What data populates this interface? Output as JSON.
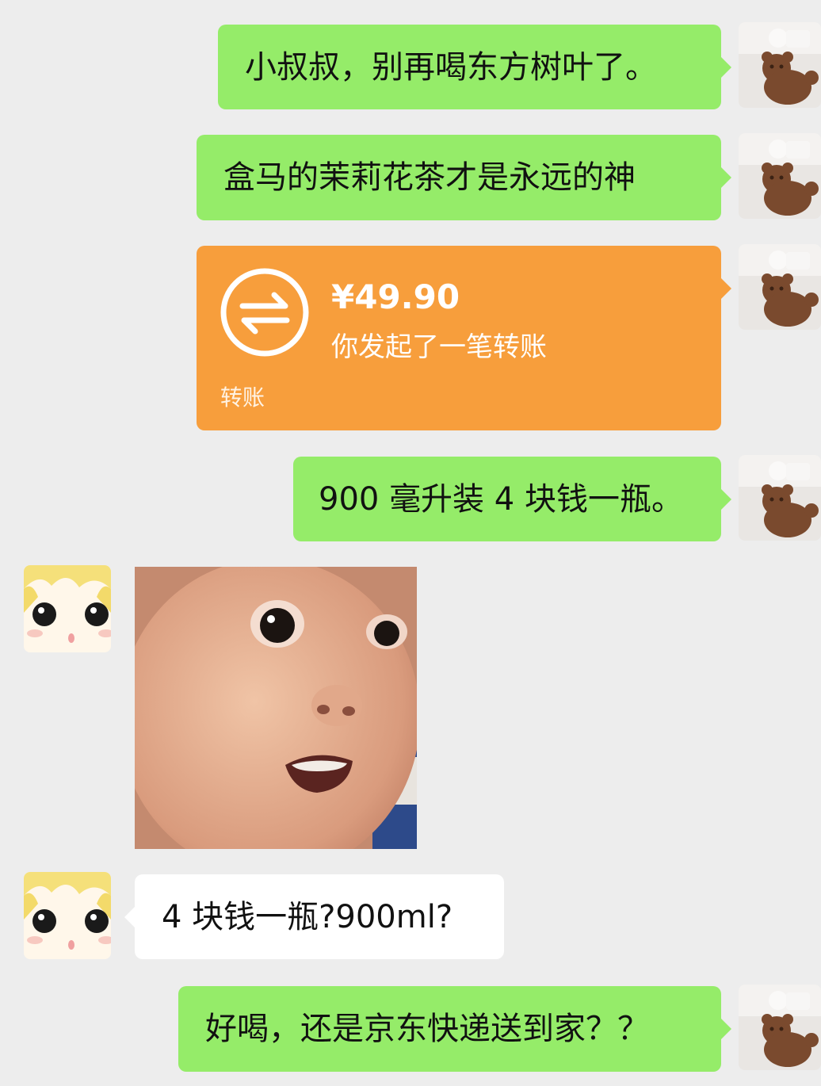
{
  "messages": {
    "m1": "小叔叔，别再喝东方树叶了。",
    "m2": "盒马的茉莉花茶才是永远的神",
    "m4": "900 毫升装 4 块钱一瓶。",
    "m6": "4 块钱一瓶?900ml?",
    "m7": "好喝，还是京东快递送到家？？"
  },
  "transfer": {
    "amount": "¥49.90",
    "description": "你发起了一笔转账",
    "label": "转账"
  },
  "colors": {
    "background": "#ededed",
    "my_bubble": "#95ec69",
    "their_bubble": "#ffffff",
    "transfer_card": "#f79e3c"
  },
  "icons": {
    "transfer": "transfer-arrows-icon",
    "my_avatar": "gingerbread-avatar",
    "their_avatar": "anime-face-avatar"
  }
}
